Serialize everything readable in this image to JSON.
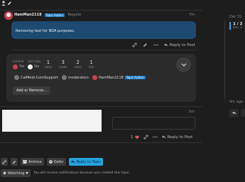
{
  "top_icons": [
    "user-icon",
    "pencil-icon"
  ],
  "post1": {
    "username": "HamMan2118",
    "badge": "Topic Author",
    "role": "Regular",
    "time": "7m",
    "body": "Removing text for NDA purposes.",
    "reply_label": "Reply to Post"
  },
  "topic_map": {
    "created_label": "created",
    "created_value": "7m",
    "last_reply_label": "last reply",
    "last_reply_value": "5m",
    "stats": [
      {
        "num": "1",
        "label": "reply"
      },
      {
        "num": "3",
        "label": "views"
      },
      {
        "num": "2",
        "label": "users"
      },
      {
        "num": "1",
        "label": "like"
      }
    ],
    "participants": [
      {
        "name": "CalMedi-ComSupport",
        "color": "#8a8a8a"
      },
      {
        "name": "moderators",
        "color": "#8a8a8a"
      },
      {
        "name": "HamMan2118",
        "color": "#c8424d"
      }
    ],
    "participant_badge": "Topic Author",
    "add_remove_label": "Add or Remove..."
  },
  "post2": {
    "time": "5m",
    "like_count": "1",
    "reply_label": "Reply to Post"
  },
  "footer": {
    "archive_label": "Archive",
    "defer_label": "Defer",
    "reply_topic_label": "Reply to Topic",
    "watching_label": "Watching",
    "notification_text": "You will receive notifications because you created this topic."
  },
  "sidebar": {
    "date_top": "Dec 31",
    "progress": "1 / 2",
    "date_sub": "Dec 2",
    "ago": "4m ago"
  }
}
